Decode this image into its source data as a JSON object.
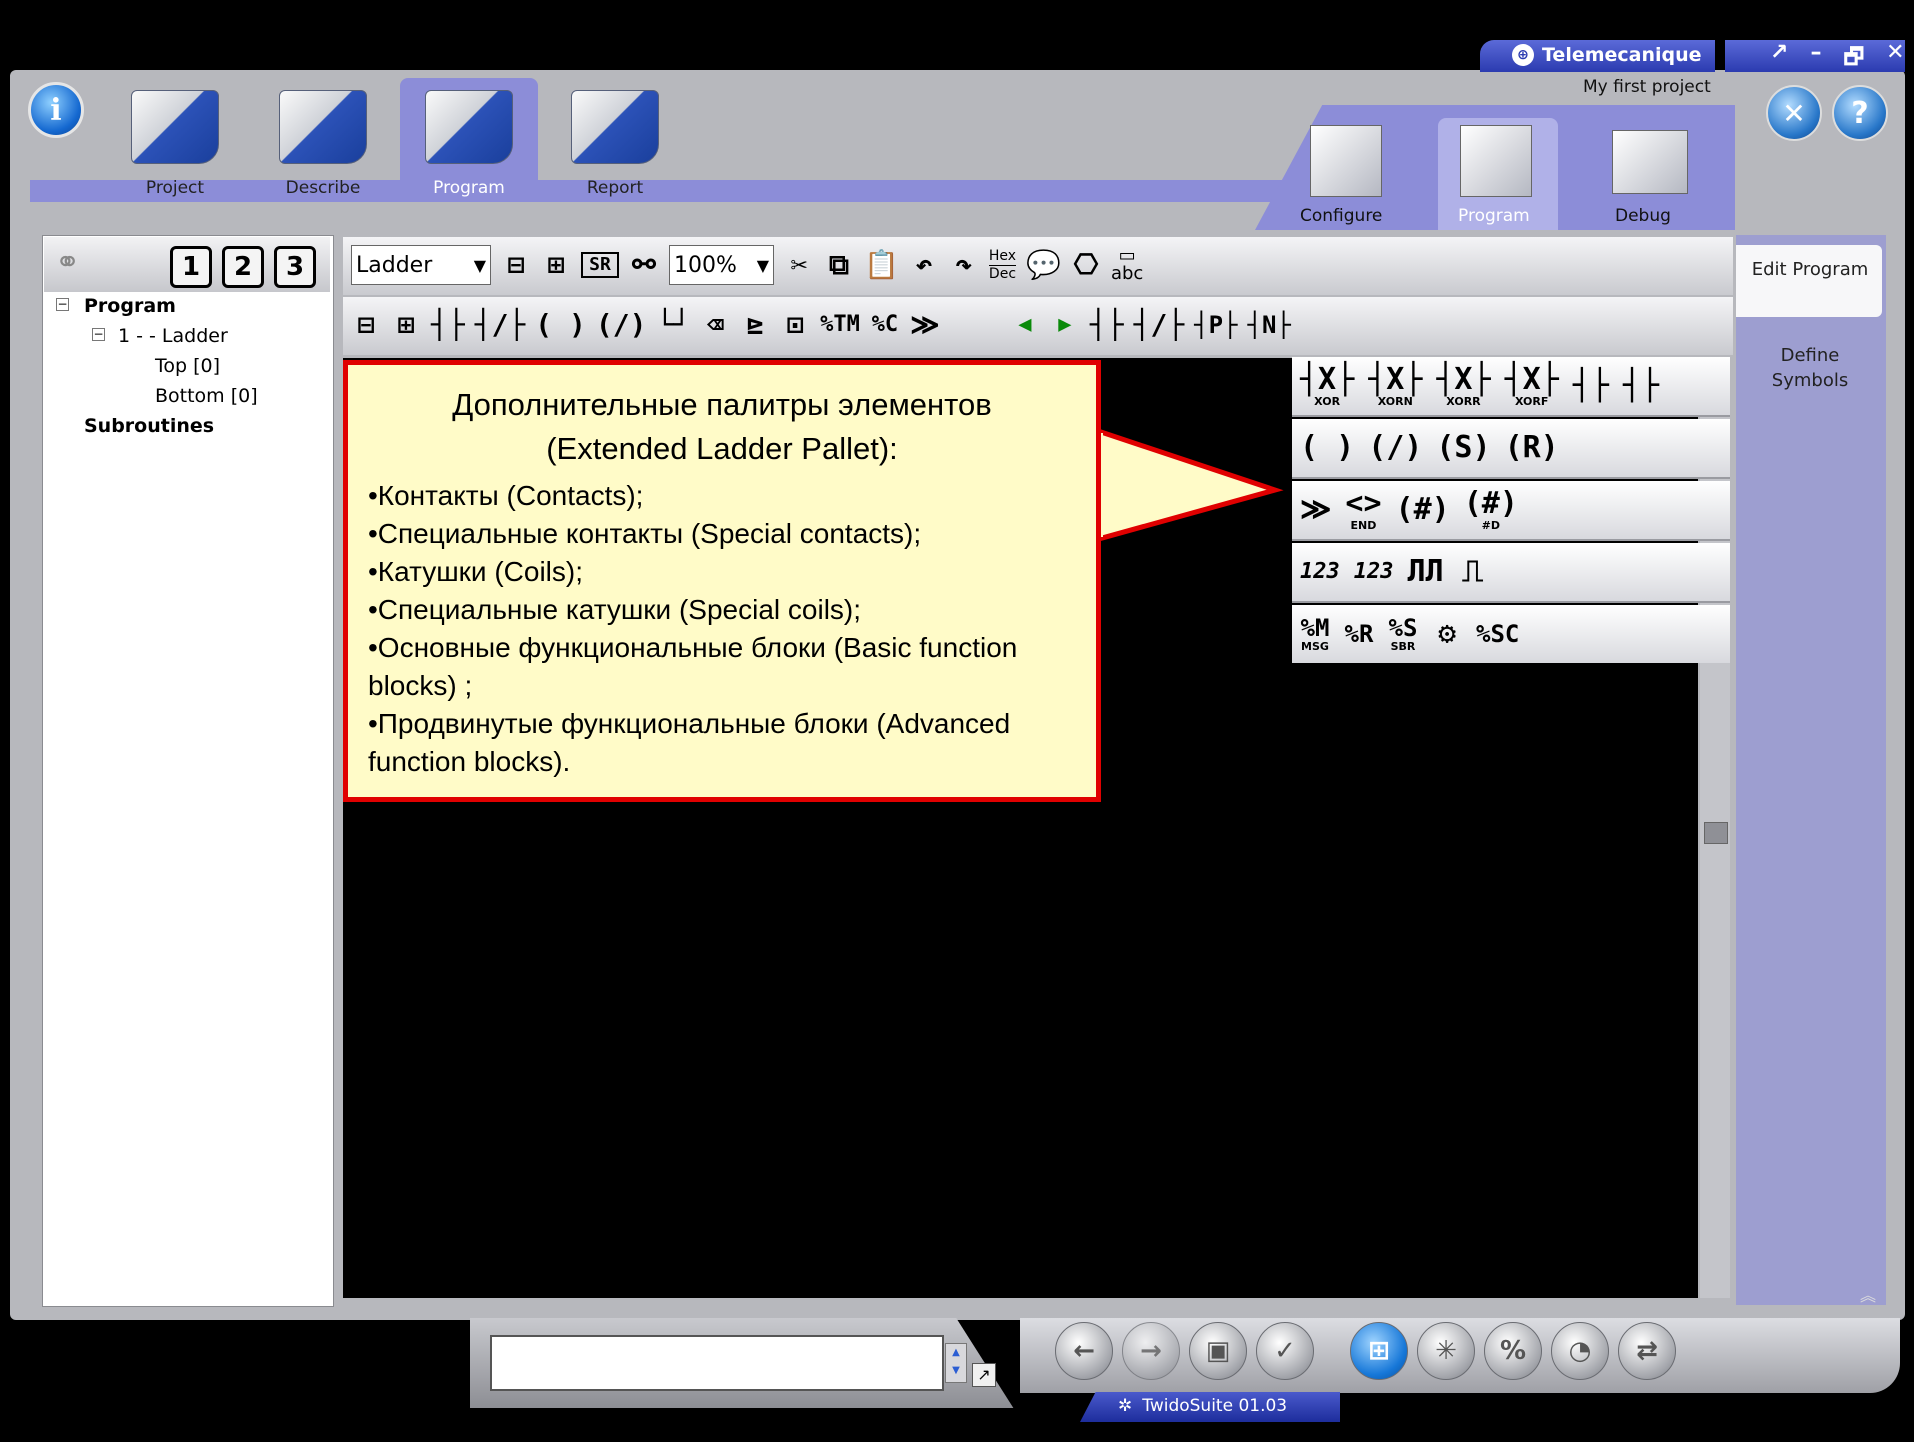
{
  "brand": {
    "name": "Telemecanique",
    "project": "My first project"
  },
  "window_controls": {
    "restore": "↗",
    "minimize": "–",
    "maximize": "🗗",
    "close": "✕"
  },
  "main_tabs": [
    {
      "label": "Project",
      "icon": "project-folder-icon"
    },
    {
      "label": "Describe",
      "icon": "describe-folder-icon"
    },
    {
      "label": "Program",
      "icon": "program-folder-icon"
    },
    {
      "label": "Report",
      "icon": "report-folder-icon"
    }
  ],
  "sub_tabs": [
    {
      "label": "Configure"
    },
    {
      "label": "Program"
    },
    {
      "label": "Debug"
    }
  ],
  "right_panel": {
    "edit_program": "Edit Program",
    "define_symbols": "Define Symbols"
  },
  "tree": {
    "view_buttons": [
      "1",
      "2",
      "3"
    ],
    "program": "Program",
    "ladder": "1 -  - Ladder",
    "top": "Top [0]",
    "bottom": "Bottom [0]",
    "subroutines": "Subroutines"
  },
  "toolbar1": {
    "language": "Ladder",
    "zoom": "100%",
    "hex": "Hex",
    "dec": "Dec",
    "abc": "abc"
  },
  "toolbar2": {
    "tm": "%TM",
    "c": "%C"
  },
  "palette": {
    "row1_labels": [
      "XOR",
      "XORN",
      "XORR",
      "XORF"
    ],
    "row3_labels": [
      "END",
      "#D"
    ],
    "row5": {
      "pulse": "ЛЛ",
      "num1": "123",
      "num2": "123"
    },
    "row6": {
      "m": "%M",
      "m_sub": "MSG",
      "r": "%R",
      "s": "%S",
      "s_sub": "SBR",
      "sc": "%SC"
    }
  },
  "callout": {
    "title": "Дополнительные палитры элементов (Extended Ladder Pallet):",
    "items": [
      "•Контакты (Contacts);",
      "•Специальные контакты (Special contacts);",
      "•Катушки (Coils);",
      "•Специальные катушки (Special coils);",
      "•Основные функциональные блоки (Basic function blocks) ;",
      "•Продвинутые функциональные блоки (Advanced function blocks)."
    ]
  },
  "status": {
    "app": "TwidoSuite 01.03"
  },
  "colors": {
    "accent": "#8c8dd8",
    "callout_border": "#e00000",
    "callout_fill": "#fffbc8"
  }
}
